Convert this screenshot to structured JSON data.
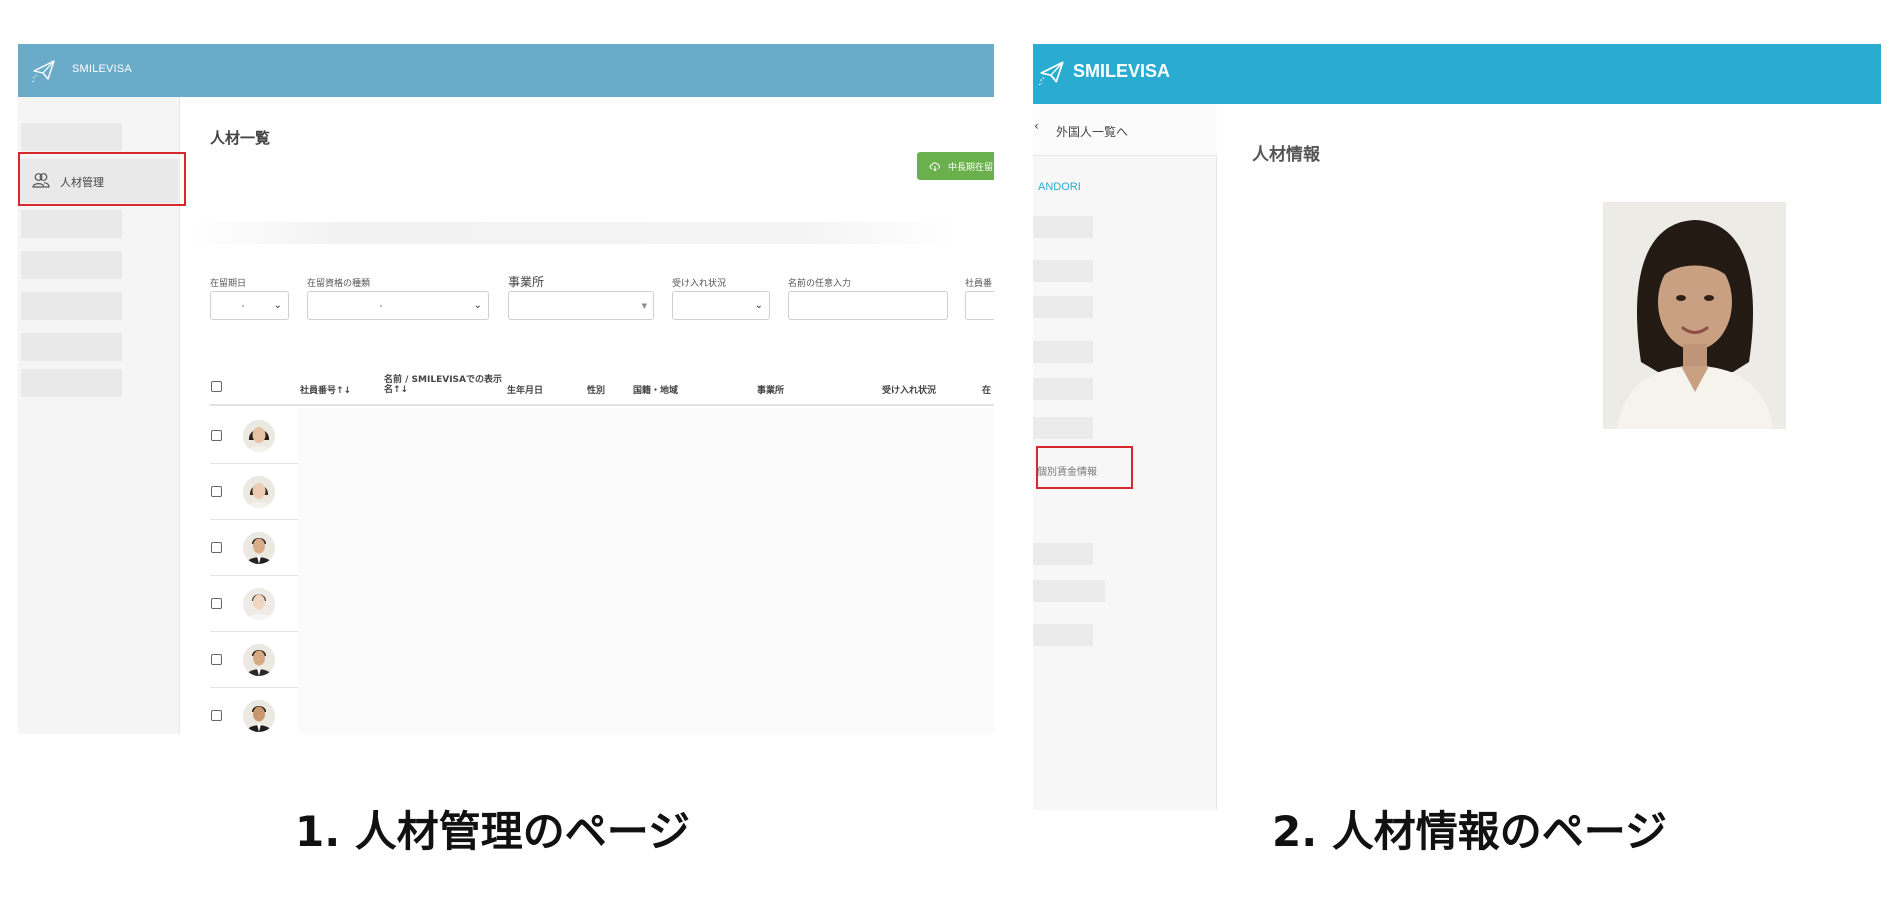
{
  "panel1": {
    "brand": "SMILEVISA",
    "sidebar_active_label": "人材管理",
    "page_title": "人材一覧",
    "action_button_label": "中長期在留",
    "filters": [
      {
        "label": "在留期日"
      },
      {
        "label": "在留資格の種類"
      },
      {
        "label": "事業所"
      },
      {
        "label": "受け入れ状況"
      },
      {
        "label": "名前の任意入力"
      },
      {
        "label": "社員番"
      }
    ],
    "table_headers": {
      "employee_no": "社員番号↑↓",
      "name": "名前 / SMILEVISAでの表示名↑↓",
      "birthdate": "生年月日",
      "gender": "性別",
      "nationality": "国籍・地域",
      "office": "事業所",
      "acceptance": "受け入れ状況",
      "status": "在"
    }
  },
  "panel2": {
    "brand": "SMILEVISA",
    "back_link": "外国人一覧へ",
    "company_label": "ANDORI",
    "highlighted_item": "個別賃金情報",
    "page_title": "人材情報"
  },
  "captions": {
    "caption1": "1. 人材管理のページ",
    "caption2": "2. 人材情報のページ"
  },
  "colors": {
    "header1": "#6aabc9",
    "header2": "#29acd0",
    "highlight": "#d9272e",
    "action_button": "#6ab04c"
  }
}
